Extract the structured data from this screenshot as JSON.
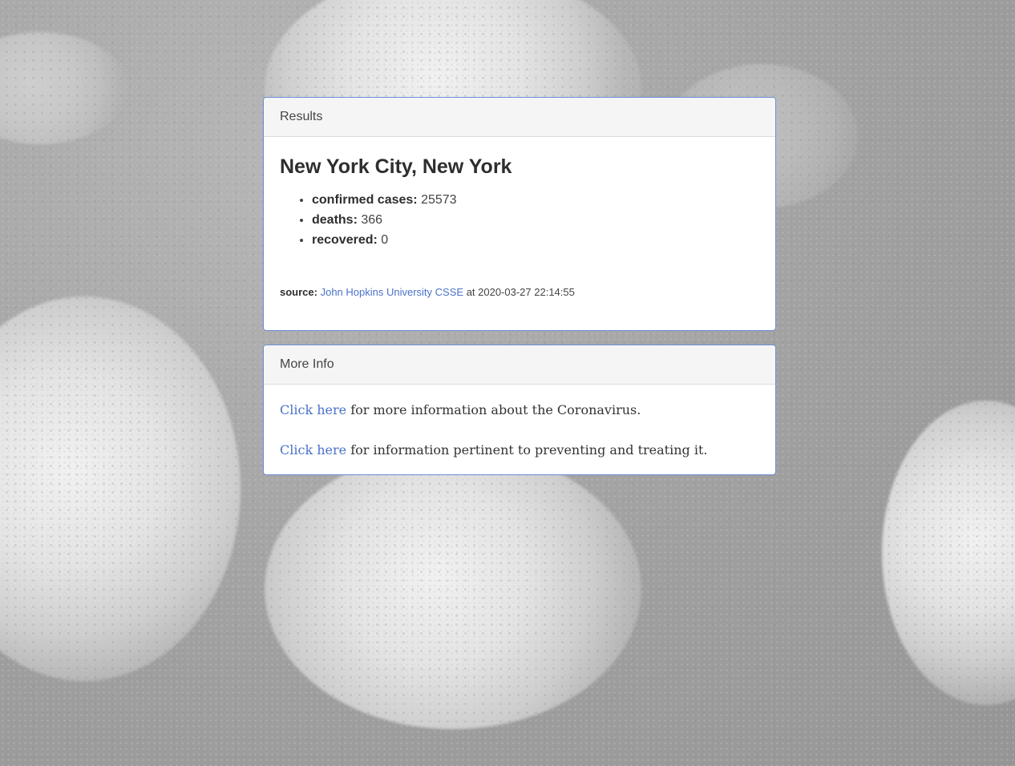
{
  "results": {
    "header": "Results",
    "title": "New York City, New York",
    "stats": [
      {
        "label": "confirmed cases:",
        "value": "25573"
      },
      {
        "label": "deaths:",
        "value": "366"
      },
      {
        "label": "recovered:",
        "value": "0"
      }
    ],
    "source": {
      "label": "source:",
      "link_text": "John Hopkins University CSSE",
      "at_text": "at 2020-03-27 22:14:55"
    }
  },
  "more_info": {
    "header": "More Info",
    "items": [
      {
        "link_text": "Click here",
        "text": "for more information about the Coronavirus."
      },
      {
        "link_text": "Click here",
        "text": "for information pertinent to preventing and treating it."
      }
    ]
  },
  "colors": {
    "link": "#4a72c9",
    "card_border": "#6b8ed6",
    "card_header_bg": "#f5f5f5"
  }
}
